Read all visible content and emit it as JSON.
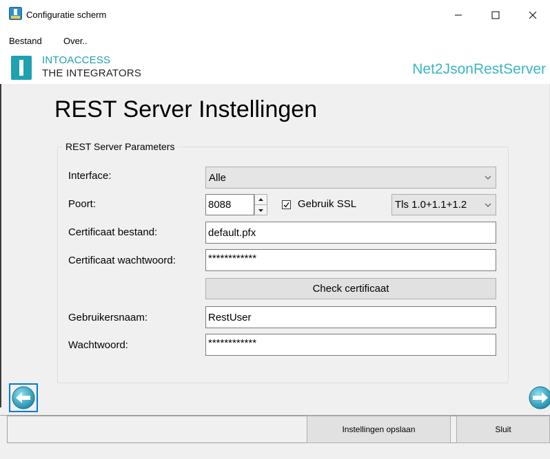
{
  "window": {
    "title": "Configuratie scherm",
    "minimize_glyph": "—",
    "maximize_glyph": "☐",
    "close_glyph": "✕"
  },
  "menu": {
    "items": [
      "Bestand",
      "Over.."
    ]
  },
  "brand": {
    "logo_line1": "INTOACCESS",
    "logo_line2": "THE INTEGRATORS",
    "app_name": "Net2JsonRestServer",
    "accent": "#1fa1b0"
  },
  "page": {
    "title": "REST Server Instellingen"
  },
  "form": {
    "group_title": "REST Server Parameters",
    "interface": {
      "label": "Interface:",
      "value": "Alle"
    },
    "poort": {
      "label": "Poort:",
      "value": "8088"
    },
    "ssl": {
      "label": "Gebruik SSL",
      "checked": true
    },
    "tls": {
      "value": "Tls 1.0+1.1+1.2"
    },
    "cert_file": {
      "label": "Certificaat bestand:",
      "value": "default.pfx"
    },
    "cert_password": {
      "label": "Certificaat wachtwoord:",
      "value": "************"
    },
    "check_cert_button": "Check certificaat",
    "username": {
      "label": "Gebruikersnaam:",
      "value": "RestUser"
    },
    "password": {
      "label": "Wachtwoord:",
      "value": "************"
    }
  },
  "footer": {
    "save_button": "Instellingen opslaan",
    "close_button": "Sluit"
  },
  "icons": {
    "app": "app-icon",
    "prev": "arrow-left-icon",
    "next": "arrow-right-icon"
  }
}
